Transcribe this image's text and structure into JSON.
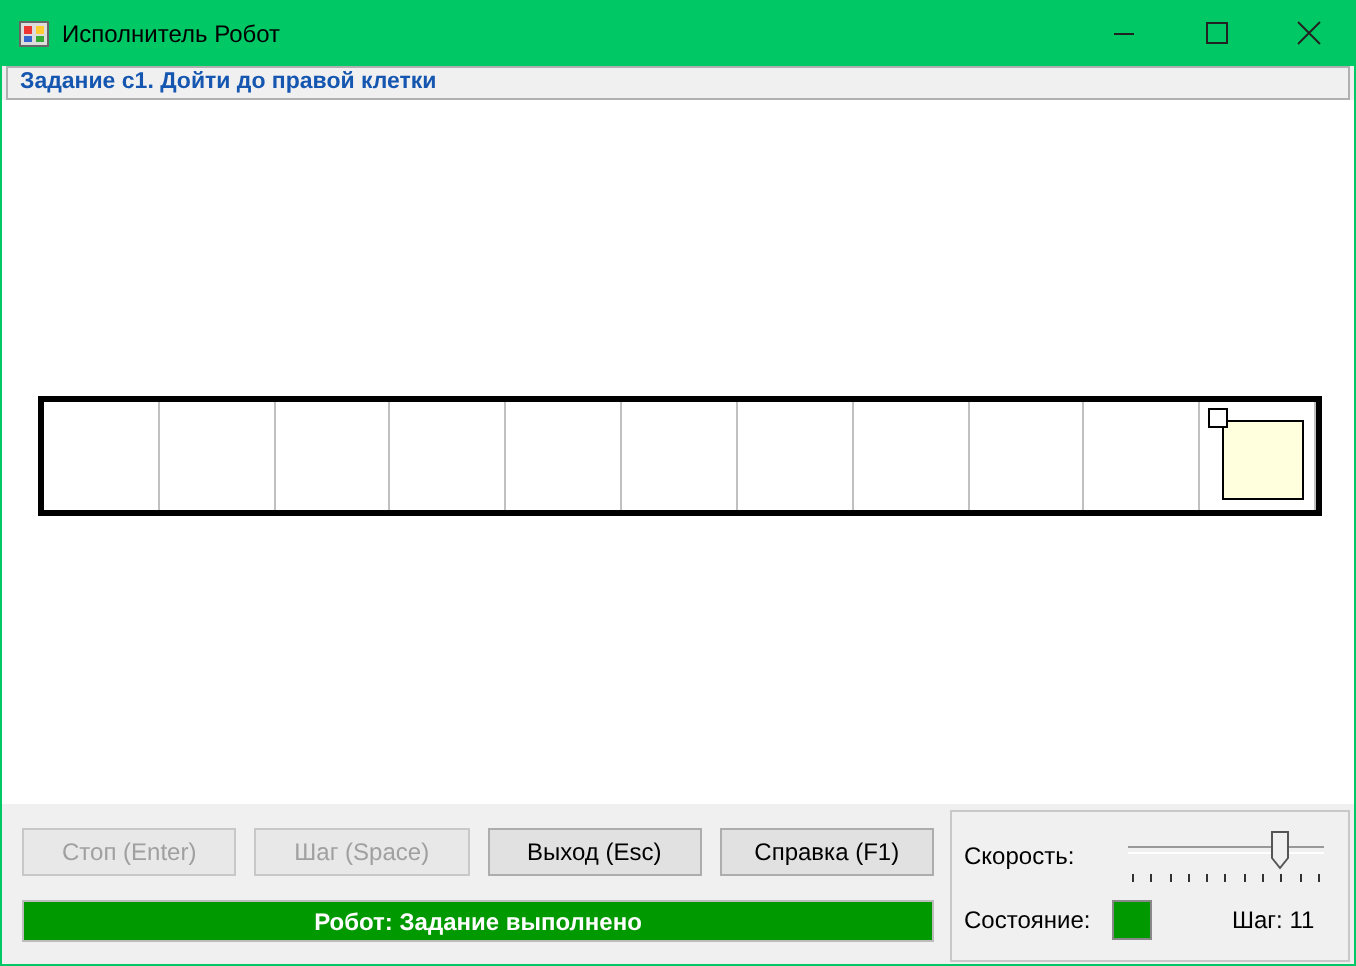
{
  "window": {
    "title": "Исполнитель Робот"
  },
  "task": {
    "text": "Задание с1. Дойти до правой клетки"
  },
  "field": {
    "cells": [
      {
        "robot": false
      },
      {
        "robot": false
      },
      {
        "robot": false
      },
      {
        "robot": false
      },
      {
        "robot": false
      },
      {
        "robot": false
      },
      {
        "robot": false
      },
      {
        "robot": false
      },
      {
        "robot": false
      },
      {
        "robot": false
      },
      {
        "robot": true
      }
    ]
  },
  "buttons": [
    {
      "label": "Стоп (Enter)",
      "disabled": true
    },
    {
      "label": "Шаг (Space)",
      "disabled": true
    },
    {
      "label": "Выход (Esc)",
      "disabled": false
    },
    {
      "label": "Справка (F1)",
      "disabled": false
    }
  ],
  "status_bar": {
    "text": "Робот: Задание выполнено",
    "color": "#009900"
  },
  "speed": {
    "label": "Скорость:",
    "level": 0.8
  },
  "state": {
    "label": "Состояние:",
    "color": "#009900"
  },
  "step": {
    "text": "Шаг: 11"
  }
}
